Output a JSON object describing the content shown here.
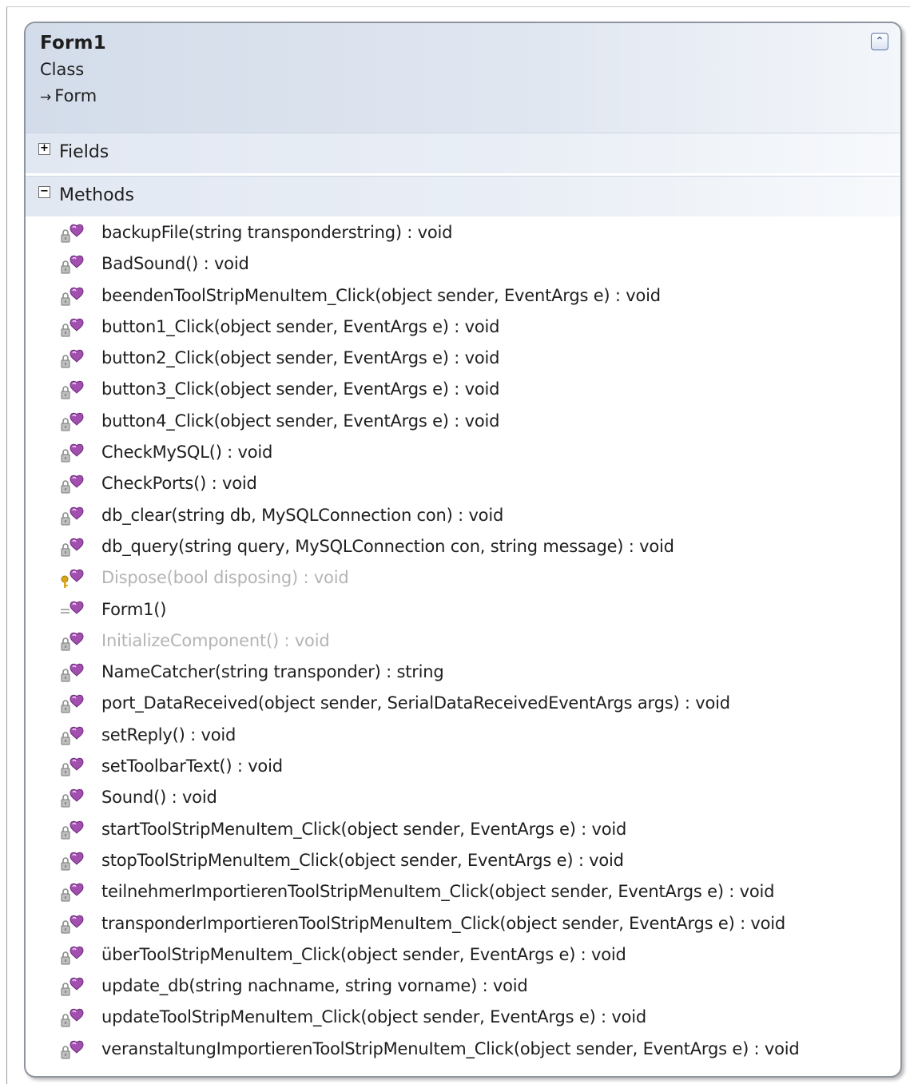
{
  "class": {
    "name": "Form1",
    "kind": "Class",
    "base": "Form",
    "base_arrow": "→"
  },
  "header": {
    "collapse_glyph": "⌃"
  },
  "sections": {
    "fields": {
      "label": "Fields",
      "expander": "+"
    },
    "methods": {
      "label": "Methods",
      "expander": "−"
    }
  },
  "methods": [
    {
      "text": "backupFile(string transponderstring) : void",
      "icon": "private-method-icon",
      "dim": false
    },
    {
      "text": "BadSound() : void",
      "icon": "private-method-icon",
      "dim": false
    },
    {
      "text": "beendenToolStripMenuItem_Click(object sender, EventArgs e) : void",
      "icon": "private-method-icon",
      "dim": false
    },
    {
      "text": "button1_Click(object sender, EventArgs e) : void",
      "icon": "private-method-icon",
      "dim": false
    },
    {
      "text": "button2_Click(object sender, EventArgs e) : void",
      "icon": "private-method-icon",
      "dim": false
    },
    {
      "text": "button3_Click(object sender, EventArgs e) : void",
      "icon": "private-method-icon",
      "dim": false
    },
    {
      "text": "button4_Click(object sender, EventArgs e) : void",
      "icon": "private-method-icon",
      "dim": false
    },
    {
      "text": "CheckMySQL() : void",
      "icon": "private-method-icon",
      "dim": false
    },
    {
      "text": "CheckPorts() : void",
      "icon": "private-method-icon",
      "dim": false
    },
    {
      "text": "db_clear(string db, MySQLConnection con) : void",
      "icon": "private-method-icon",
      "dim": false
    },
    {
      "text": "db_query(string query, MySQLConnection con, string message) : void",
      "icon": "private-method-icon",
      "dim": false
    },
    {
      "text": "Dispose(bool disposing) : void",
      "icon": "protected-method-icon",
      "dim": true
    },
    {
      "text": "Form1()",
      "icon": "public-method-icon",
      "dim": false
    },
    {
      "text": "InitializeComponent() : void",
      "icon": "private-method-icon",
      "dim": true
    },
    {
      "text": "NameCatcher(string transponder) : string",
      "icon": "private-method-icon",
      "dim": false
    },
    {
      "text": "port_DataReceived(object sender, SerialDataReceivedEventArgs args) : void",
      "icon": "private-method-icon",
      "dim": false
    },
    {
      "text": "setReply() : void",
      "icon": "private-method-icon",
      "dim": false
    },
    {
      "text": "setToolbarText() : void",
      "icon": "private-method-icon",
      "dim": false
    },
    {
      "text": "Sound() : void",
      "icon": "private-method-icon",
      "dim": false
    },
    {
      "text": "startToolStripMenuItem_Click(object sender, EventArgs e) : void",
      "icon": "private-method-icon",
      "dim": false
    },
    {
      "text": "stopToolStripMenuItem_Click(object sender, EventArgs e) : void",
      "icon": "private-method-icon",
      "dim": false
    },
    {
      "text": "teilnehmerImportierenToolStripMenuItem_Click(object sender, EventArgs e) : void",
      "icon": "private-method-icon",
      "dim": false
    },
    {
      "text": "transponderImportierenToolStripMenuItem_Click(object sender, EventArgs e) : void",
      "icon": "private-method-icon",
      "dim": false
    },
    {
      "text": "überToolStripMenuItem_Click(object sender, EventArgs e) : void",
      "icon": "private-method-icon",
      "dim": false
    },
    {
      "text": "update_db(string nachname, string vorname) : void",
      "icon": "private-method-icon",
      "dim": false
    },
    {
      "text": "updateToolStripMenuItem_Click(object sender, EventArgs e) : void",
      "icon": "private-method-icon",
      "dim": false
    },
    {
      "text": "veranstaltungImportierenToolStripMenuItem_Click(object sender, EventArgs e) : void",
      "icon": "private-method-icon",
      "dim": false
    }
  ],
  "colors": {
    "method_cube": "#a24fb0",
    "lock": "#8a8a8a",
    "key": "#d8a51c",
    "dim_text": "#b4b4b4"
  }
}
